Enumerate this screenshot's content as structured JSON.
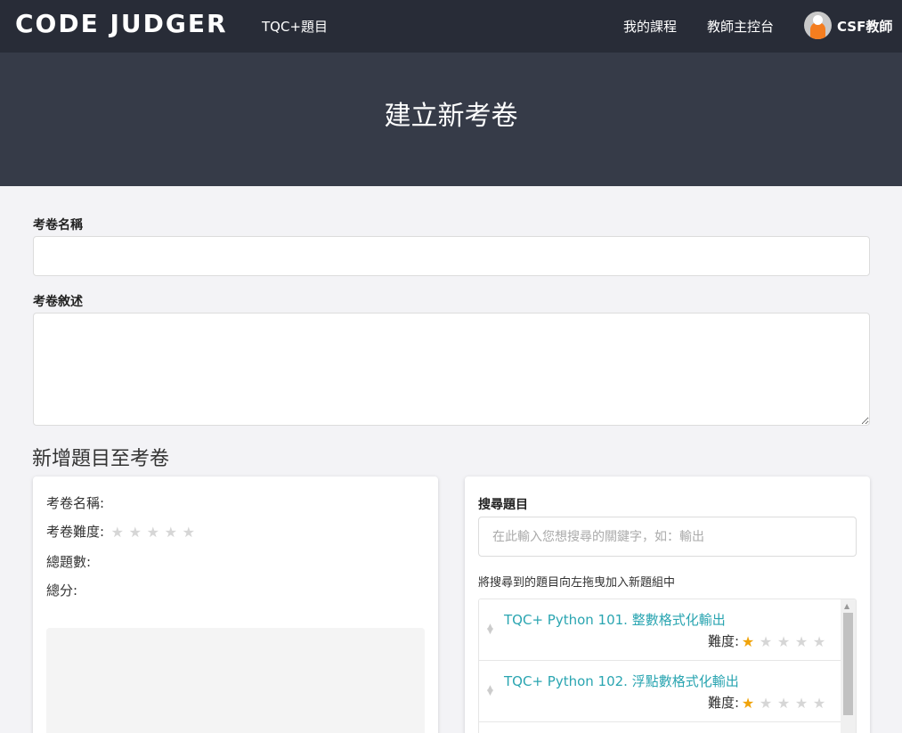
{
  "nav": {
    "logo": "CODE JUDGER",
    "tqc": "TQC+題目",
    "my_courses": "我的課程",
    "teacher_console": "教師主控台",
    "user": "CSF教師"
  },
  "banner": {
    "title": "建立新考卷"
  },
  "form": {
    "name_label": "考卷名稱",
    "name_value": "",
    "desc_label": "考卷敘述",
    "desc_value": ""
  },
  "section": {
    "title": "新增題目至考卷"
  },
  "exam_info": {
    "name_label": "考卷名稱:",
    "difficulty_label": "考卷難度:",
    "difficulty": 0,
    "total_count_label": "總題數:",
    "total_score_label": "總分:"
  },
  "search": {
    "label": "搜尋題目",
    "placeholder": "在此輸入您想搜尋的關鍵字，如：輸出",
    "value": "",
    "hint": "將搜尋到的題目向左拖曳加入新題組中"
  },
  "results": [
    {
      "title": "TQC+ Python 101. 整數格式化輸出",
      "difficulty_label": "難度:",
      "difficulty": 1
    },
    {
      "title": "TQC+ Python 102. 浮點數格式化輸出",
      "difficulty_label": "難度:",
      "difficulty": 1
    }
  ],
  "colors": {
    "nav_bg": "#282c37",
    "banner_bg": "#363b48",
    "link": "#2aa5b1",
    "star_on": "#f0a30a",
    "star_off": "#d6d6d6"
  },
  "icons": {
    "star": "star-icon",
    "drag": "drag-handle-icon",
    "avatar": "user-avatar-icon"
  }
}
